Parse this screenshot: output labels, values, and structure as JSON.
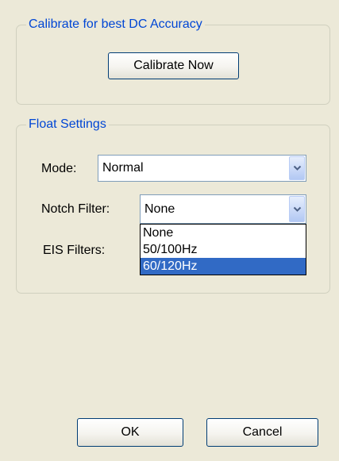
{
  "calibrate_group": {
    "title": "Calibrate for best DC Accuracy",
    "calibrate_button_label": "Calibrate Now"
  },
  "float_settings": {
    "title": "Float Settings",
    "mode": {
      "label": "Mode:",
      "value": "Normal"
    },
    "notch_filter": {
      "label": "Notch Filter:",
      "value": "None",
      "expanded": true,
      "options": [
        "None",
        "50/100Hz",
        "60/120Hz"
      ],
      "highlighted_option": "60/120Hz"
    },
    "eis_filters": {
      "label": "EIS Filters:"
    }
  },
  "buttons": {
    "ok_label": "OK",
    "cancel_label": "Cancel"
  },
  "icons": {
    "dropdown_arrow": "chevron-down-icon"
  },
  "colors": {
    "window_background": "#ECE9D8",
    "group_title": "#0046D5",
    "selection_highlight": "#316AC5",
    "field_border": "#7F9DB9",
    "button_border": "#003C74"
  }
}
